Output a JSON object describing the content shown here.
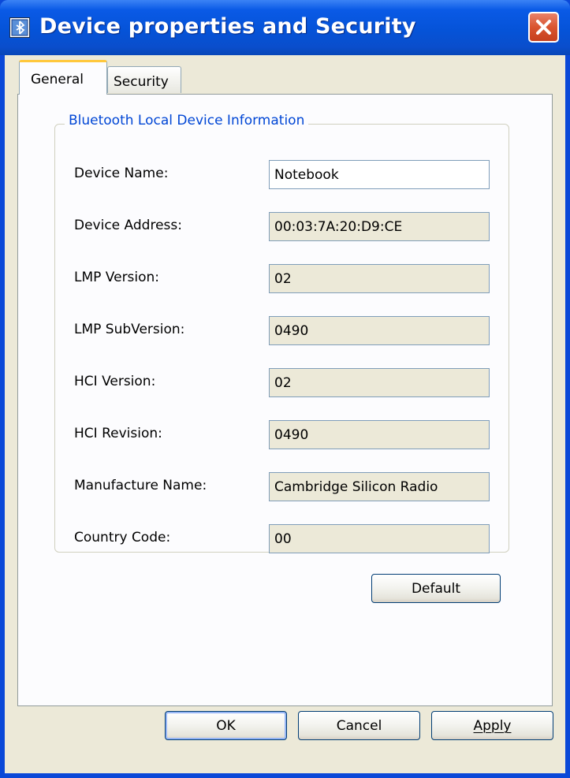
{
  "window": {
    "title": "Device properties and Security"
  },
  "tabs": [
    {
      "label": "General",
      "selected": true
    },
    {
      "label": "Security",
      "selected": false
    }
  ],
  "group": {
    "title": "Bluetooth Local Device Information"
  },
  "fields": [
    {
      "label": "Device Name:",
      "value": "Notebook",
      "editable": true
    },
    {
      "label": "Device Address:",
      "value": "00:03:7A:20:D9:CE",
      "editable": false
    },
    {
      "label": "LMP Version:",
      "value": "02",
      "editable": false
    },
    {
      "label": "LMP SubVersion:",
      "value": "0490",
      "editable": false
    },
    {
      "label": "HCI Version:",
      "value": "02",
      "editable": false
    },
    {
      "label": "HCI Revision:",
      "value": "0490",
      "editable": false
    },
    {
      "label": "Manufacture Name:",
      "value": "Cambridge Silicon Radio",
      "editable": false
    },
    {
      "label": "Country Code:",
      "value": "00",
      "editable": false
    }
  ],
  "buttons": {
    "default": "Default",
    "ok": "OK",
    "cancel": "Cancel",
    "apply": "Apply"
  },
  "colors": {
    "titlebar": "#0553d8",
    "dialog_face": "#ece9d8",
    "group_title": "#0046d5",
    "close_button": "#d9542f",
    "tab_highlight": "#ffc83c"
  },
  "icons": {
    "app": "bluetooth-properties-icon",
    "close": "close-icon"
  }
}
